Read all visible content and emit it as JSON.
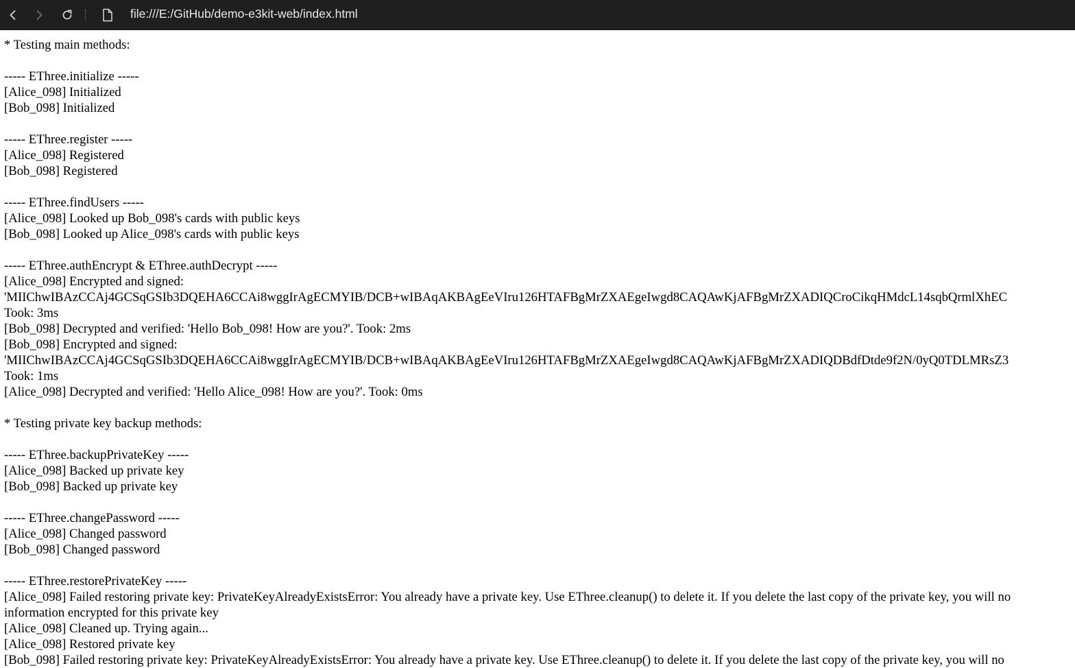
{
  "browser": {
    "url": "file:///E:/GitHub/demo-e3kit-web/index.html",
    "icons": {
      "back": "back-arrow-icon",
      "forward": "forward-arrow-icon",
      "reload": "reload-icon",
      "page": "file-page-icon"
    }
  },
  "log": [
    "* Testing main methods:",
    "",
    "----- EThree.initialize -----",
    "[Alice_098] Initialized",
    "[Bob_098] Initialized",
    "",
    "----- EThree.register -----",
    "[Alice_098] Registered",
    "[Bob_098] Registered",
    "",
    "----- EThree.findUsers -----",
    "[Alice_098] Looked up Bob_098's cards with public keys",
    "[Bob_098] Looked up Alice_098's cards with public keys",
    "",
    "----- EThree.authEncrypt & EThree.authDecrypt -----",
    "[Alice_098] Encrypted and signed:",
    "'MIIChwIBAzCCAj4GCSqGSIb3DQEHA6CCAi8wggIrAgECMYIB/DCB+wIBAqAKBAgEeVIru126HTAFBgMrZXAEgeIwgd8CAQAwKjAFBgMrZXADIQCroCikqHMdcL14sqbQrmlXhEC",
    "Took: 3ms",
    "[Bob_098] Decrypted and verified: 'Hello Bob_098! How are you?'. Took: 2ms",
    "[Bob_098] Encrypted and signed:",
    "'MIIChwIBAzCCAj4GCSqGSIb3DQEHA6CCAi8wggIrAgECMYIB/DCB+wIBAqAKBAgEeVIru126HTAFBgMrZXAEgeIwgd8CAQAwKjAFBgMrZXADIQDBdfDtde9f2N/0yQ0TDLMRsZ3",
    "Took: 1ms",
    "[Alice_098] Decrypted and verified: 'Hello Alice_098! How are you?'. Took: 0ms",
    "",
    "* Testing private key backup methods:",
    "",
    "----- EThree.backupPrivateKey -----",
    "[Alice_098] Backed up private key",
    "[Bob_098] Backed up private key",
    "",
    "----- EThree.changePassword -----",
    "[Alice_098] Changed password",
    "[Bob_098] Changed password",
    "",
    "----- EThree.restorePrivateKey -----",
    "[Alice_098] Failed restoring private key: PrivateKeyAlreadyExistsError: You already have a private key. Use EThree.cleanup() to delete it. If you delete the last copy of the private key, you will no",
    "information encrypted for this private key",
    "[Alice_098] Cleaned up. Trying again...",
    "[Alice_098] Restored private key",
    "[Bob_098] Failed restoring private key: PrivateKeyAlreadyExistsError: You already have a private key. Use EThree.cleanup() to delete it. If you delete the last copy of the private key, you will no"
  ]
}
